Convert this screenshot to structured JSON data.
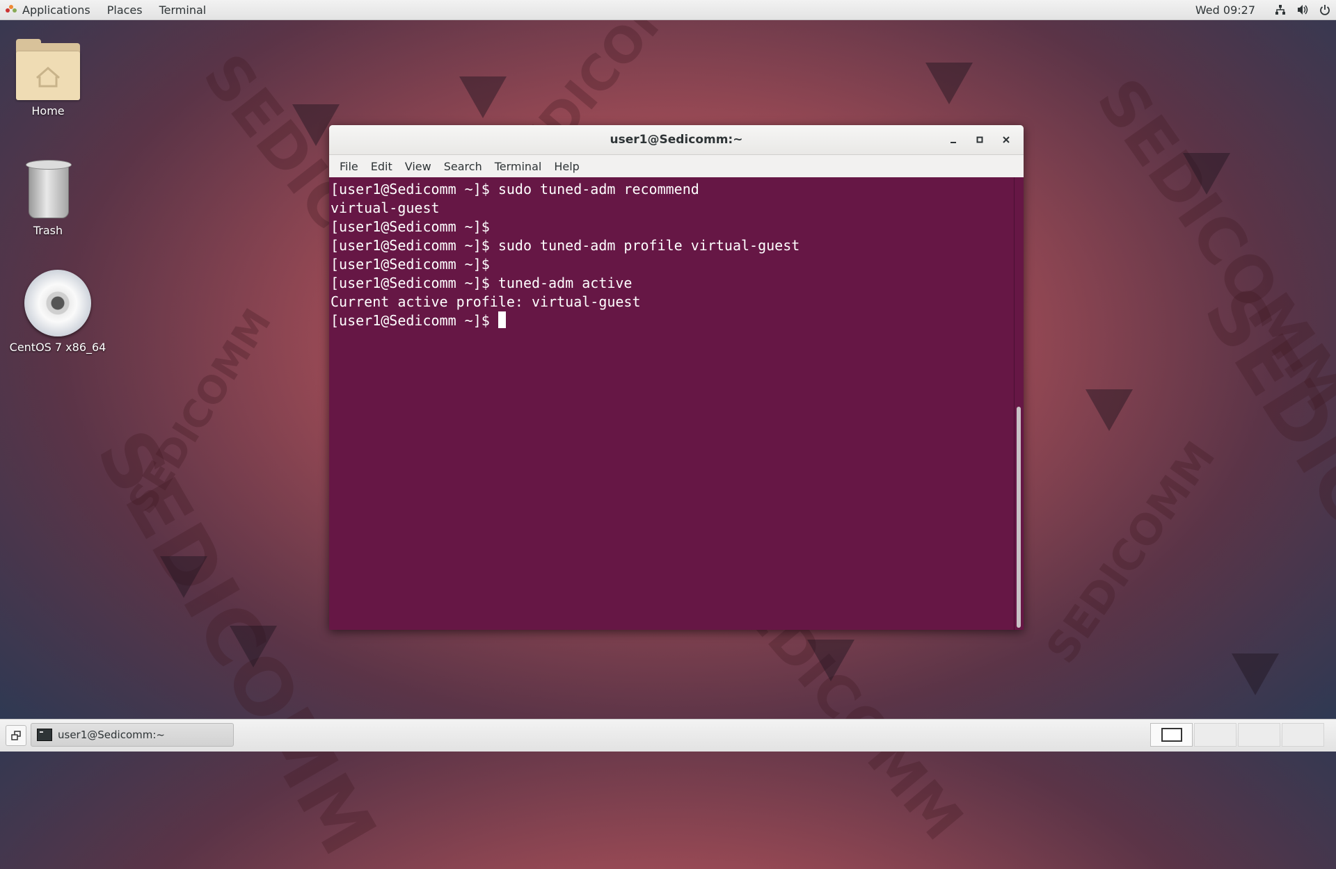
{
  "topbar": {
    "applications": "Applications",
    "places": "Places",
    "terminal": "Terminal",
    "clock": "Wed 09:27",
    "icons": [
      "network-icon",
      "volume-icon",
      "power-icon"
    ]
  },
  "desktop": {
    "icons": [
      {
        "label": "Home",
        "icon": "home-folder-icon"
      },
      {
        "label": "Trash",
        "icon": "trash-icon"
      },
      {
        "label": "CentOS 7 x86_64",
        "icon": "disc-icon"
      }
    ],
    "wallpaper_text": "SEDICOMM"
  },
  "window": {
    "title": "user1@Sedicomm:~",
    "controls": {
      "minimize": "–",
      "maximize": "▫",
      "close": "×"
    },
    "menu": [
      "File",
      "Edit",
      "View",
      "Search",
      "Terminal",
      "Help"
    ],
    "background": "#661745",
    "lines": [
      "[user1@Sedicomm ~]$ sudo tuned-adm recommend",
      "virtual-guest",
      "[user1@Sedicomm ~]$",
      "[user1@Sedicomm ~]$ sudo tuned-adm profile virtual-guest",
      "[user1@Sedicomm ~]$",
      "[user1@Sedicomm ~]$ tuned-adm active",
      "Current active profile: virtual-guest"
    ],
    "prompt": "[user1@Sedicomm ~]$ "
  },
  "taskbar": {
    "task_label": "user1@Sedicomm:~",
    "workspaces": 4,
    "active_workspace": 1
  }
}
